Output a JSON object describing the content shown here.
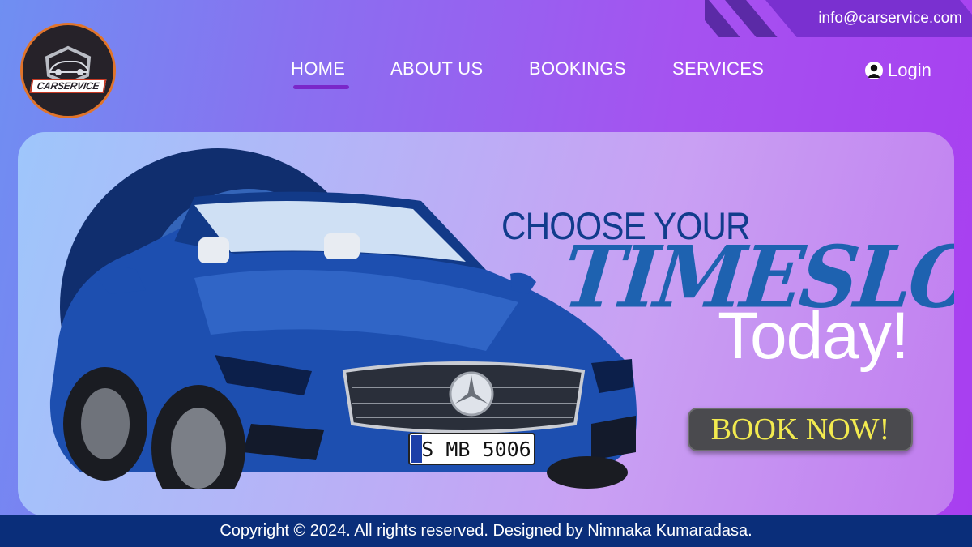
{
  "header": {
    "email": "info@carservice.com",
    "logo_text": "CARSERVICE",
    "colors": {
      "accent": "#7a27c9",
      "footer": "#0a2e7a",
      "button_text": "#f2ea4f"
    }
  },
  "nav": {
    "items": [
      {
        "label": "HOME",
        "active": true
      },
      {
        "label": "ABOUT US",
        "active": false
      },
      {
        "label": "BOOKINGS",
        "active": false
      },
      {
        "label": "SERVICES",
        "active": false
      }
    ],
    "login_label": "Login",
    "login_icon": "user-icon"
  },
  "hero": {
    "line1": "CHOOSE YOUR",
    "line2": "TIMESLOT",
    "line3": "Today!",
    "cta_label": "BOOK NOW!",
    "plate": "S MB 5006"
  },
  "footer": {
    "text": "Copyright © 2024. All rights reserved. Designed by Nimnaka Kumaradasa."
  }
}
